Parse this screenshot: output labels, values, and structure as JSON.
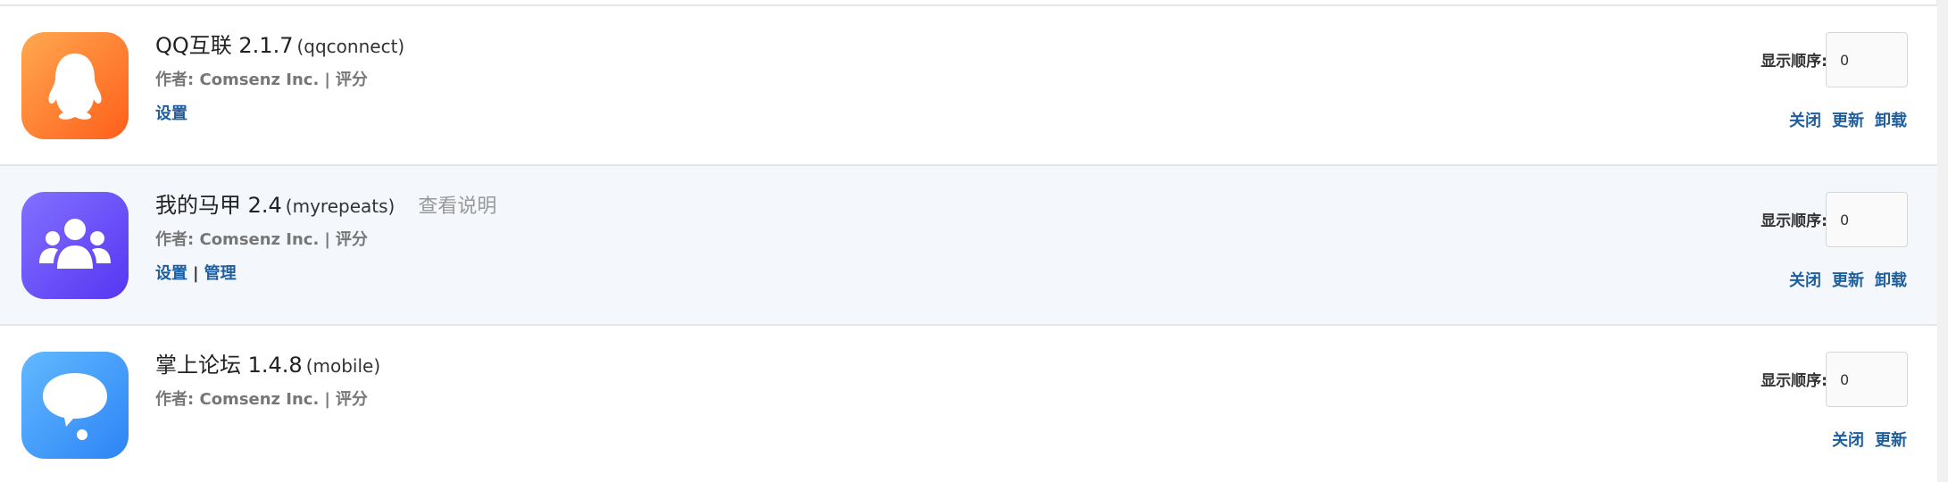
{
  "order_label": "显示顺序:",
  "author_label": "作者:",
  "rating_label": "评分",
  "plugins": [
    {
      "name": "QQ互联 2.1.7",
      "id": "(qqconnect)",
      "author": "Comsenz Inc.",
      "links": [
        "设置"
      ],
      "order_value": "0",
      "actions": [
        "关闭",
        "更新",
        "卸载"
      ],
      "icon": "qq-penguin-icon",
      "icon_colors": [
        "#ffa24a",
        "#ff6a1e"
      ]
    },
    {
      "name": "我的马甲 2.4",
      "id": "(myrepeats)",
      "description": "查看说明",
      "author": "Comsenz Inc.",
      "links": [
        "设置",
        "管理"
      ],
      "order_value": "0",
      "actions": [
        "关闭",
        "更新",
        "卸载"
      ],
      "icon": "users-group-icon",
      "icon_colors": [
        "#7f6bff",
        "#5b3df6"
      ]
    },
    {
      "name": "掌上论坛 1.4.8",
      "id": "(mobile)",
      "author": "Comsenz Inc.",
      "links": [],
      "order_value": "0",
      "actions": [
        "关闭",
        "更新"
      ],
      "icon": "chat-bubble-icon",
      "icon_colors": [
        "#5cb6ff",
        "#2f86f6"
      ]
    }
  ],
  "colors": {
    "link": "#1f5f9e",
    "row_highlight": "#f4f7fb",
    "divider": "#e4e6ea"
  }
}
